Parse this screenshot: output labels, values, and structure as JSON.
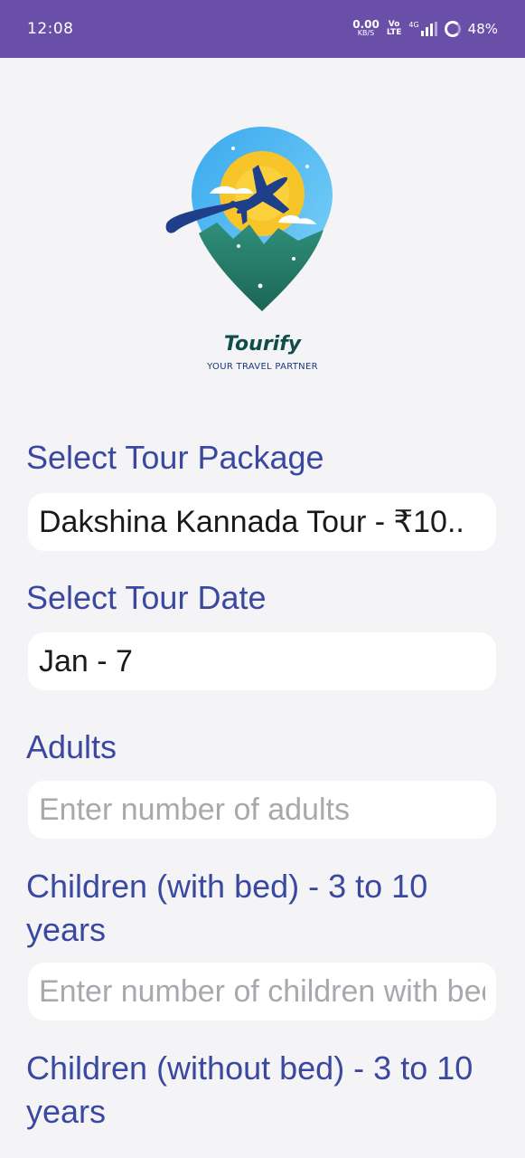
{
  "status_bar": {
    "time": "12:08",
    "speed_value": "0.00",
    "speed_unit": "KB/S",
    "volte_top": "Vo",
    "volte_bottom": "LTE",
    "network": "4G",
    "battery": "48%"
  },
  "brand": {
    "name": "Tourify",
    "tagline": "YOUR TRAVEL PARTNER"
  },
  "form": {
    "package_label": "Select Tour Package",
    "package_value": "Dakshina Kannada Tour - ₹10..",
    "date_label": "Select Tour Date",
    "date_value": "Jan - 7",
    "adults_label": "Adults",
    "adults_placeholder": "Enter number of adults",
    "children_bed_label": "Children (with bed) - 3 to 10 years",
    "children_bed_placeholder": "Enter number of children with bed",
    "children_nobed_label": "Children (without bed) - 3 to 10 years"
  },
  "colors": {
    "status_bar": "#6a4fa8",
    "label": "#3a48a0",
    "background": "#f4f4f6"
  }
}
